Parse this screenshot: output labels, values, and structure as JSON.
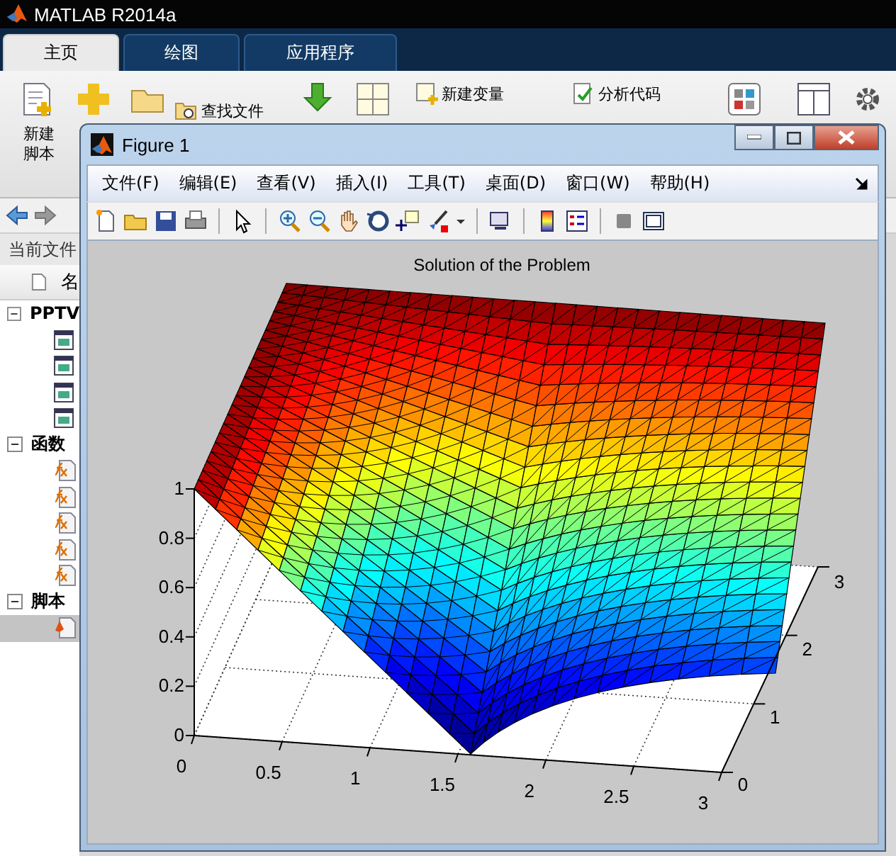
{
  "app_window": {
    "title": "MATLAB R2014a"
  },
  "ribbon_tabs": [
    {
      "label": "主页",
      "selected": true
    },
    {
      "label": "绘图",
      "selected": false
    },
    {
      "label": "应用程序",
      "selected": false
    }
  ],
  "ribbon": {
    "new_script": [
      "新建",
      "脚本"
    ],
    "find_files": "查找文件",
    "new_variable": "新建变量",
    "analyze_code": "分析代码"
  },
  "current_folder": {
    "title": "当前文件",
    "column_2": "名",
    "groups": [
      {
        "label": "PPTV",
        "expanded": true,
        "items": [
          {
            "kind": "app",
            "selected": false
          },
          {
            "kind": "app",
            "selected": false
          },
          {
            "kind": "app",
            "selected": false
          },
          {
            "kind": "app",
            "selected": false
          }
        ]
      },
      {
        "label": "函数",
        "expanded": true,
        "items": [
          {
            "kind": "function",
            "selected": false
          },
          {
            "kind": "function",
            "selected": false
          },
          {
            "kind": "function",
            "selected": false
          },
          {
            "kind": "function",
            "selected": false
          },
          {
            "kind": "function",
            "selected": false
          }
        ]
      },
      {
        "label": "脚本",
        "expanded": true,
        "items": [
          {
            "kind": "script",
            "selected": true
          }
        ]
      }
    ]
  },
  "figure": {
    "title": "Figure 1",
    "menus": [
      "文件(F)",
      "编辑(E)",
      "查看(V)",
      "插入(I)",
      "工具(T)",
      "桌面(D)",
      "窗口(W)",
      "帮助(H)"
    ],
    "plot": {
      "title": "Solution of the Problem",
      "z_ticks": [
        "1",
        "0.8",
        "0.6",
        "0.4",
        "0.2",
        "0"
      ],
      "x_ticks": [
        "0",
        "0.5",
        "1",
        "1.5",
        "2",
        "2.5",
        "3"
      ],
      "y_ticks": [
        "0",
        "1",
        "2",
        "3"
      ]
    }
  }
}
